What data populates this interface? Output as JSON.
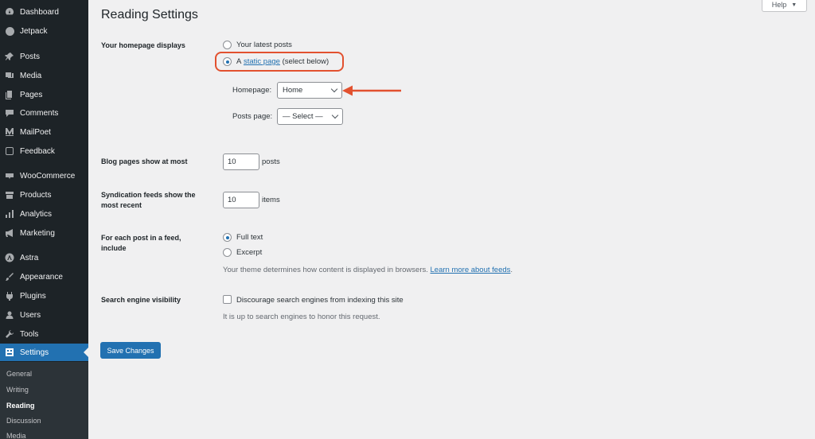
{
  "sidebar": {
    "items": [
      {
        "label": "Dashboard",
        "icon": "dashboard-icon"
      },
      {
        "label": "Jetpack",
        "icon": "jetpack-icon"
      },
      {
        "label": "Posts",
        "icon": "pin-icon"
      },
      {
        "label": "Media",
        "icon": "media-icon"
      },
      {
        "label": "Pages",
        "icon": "pages-icon"
      },
      {
        "label": "Comments",
        "icon": "comment-icon"
      },
      {
        "label": "MailPoet",
        "icon": "mailpoet-icon"
      },
      {
        "label": "Feedback",
        "icon": "feedback-icon"
      },
      {
        "label": "WooCommerce",
        "icon": "woocommerce-icon"
      },
      {
        "label": "Products",
        "icon": "products-icon"
      },
      {
        "label": "Analytics",
        "icon": "analytics-icon"
      },
      {
        "label": "Marketing",
        "icon": "megaphone-icon"
      },
      {
        "label": "Astra",
        "icon": "astra-icon"
      },
      {
        "label": "Appearance",
        "icon": "brush-icon"
      },
      {
        "label": "Plugins",
        "icon": "plugin-icon"
      },
      {
        "label": "Users",
        "icon": "user-icon"
      },
      {
        "label": "Tools",
        "icon": "wrench-icon"
      },
      {
        "label": "Settings",
        "icon": "settings-icon"
      }
    ],
    "submenu": [
      "General",
      "Writing",
      "Reading",
      "Discussion",
      "Media"
    ]
  },
  "header": {
    "help_label": "Help",
    "title": "Reading Settings"
  },
  "form": {
    "homepage_displays": {
      "label": "Your homepage displays",
      "option_latest": "Your latest posts",
      "option_static_prefix": "A",
      "option_static_link": "static page",
      "option_static_suffix": "(select below)",
      "selected": "static page",
      "homepage_label": "Homepage:",
      "homepage_value": "Home",
      "posts_page_label": "Posts page:",
      "posts_page_value": "— Select —"
    },
    "blog_pages": {
      "label": "Blog pages show at most",
      "value": "10",
      "suffix": "posts"
    },
    "syndication": {
      "label": "Syndication feeds show the most recent",
      "value": "10",
      "suffix": "items"
    },
    "feed_include": {
      "label": "For each post in a feed, include",
      "option_full": "Full text",
      "option_excerpt": "Excerpt",
      "selected": "Full text",
      "desc": "Your theme determines how content is displayed in browsers.",
      "desc_link": "Learn more about feeds",
      "desc_end": "."
    },
    "search_visibility": {
      "label": "Search engine visibility",
      "checkbox_label": "Discourage search engines from indexing this site",
      "checked": false,
      "desc": "It is up to search engines to honor this request."
    },
    "save_label": "Save Changes"
  },
  "colors": {
    "sidebar_bg": "#1d2327",
    "accent": "#2271b1",
    "annotation": "#e2512f",
    "page_bg": "#f0f0f1"
  }
}
